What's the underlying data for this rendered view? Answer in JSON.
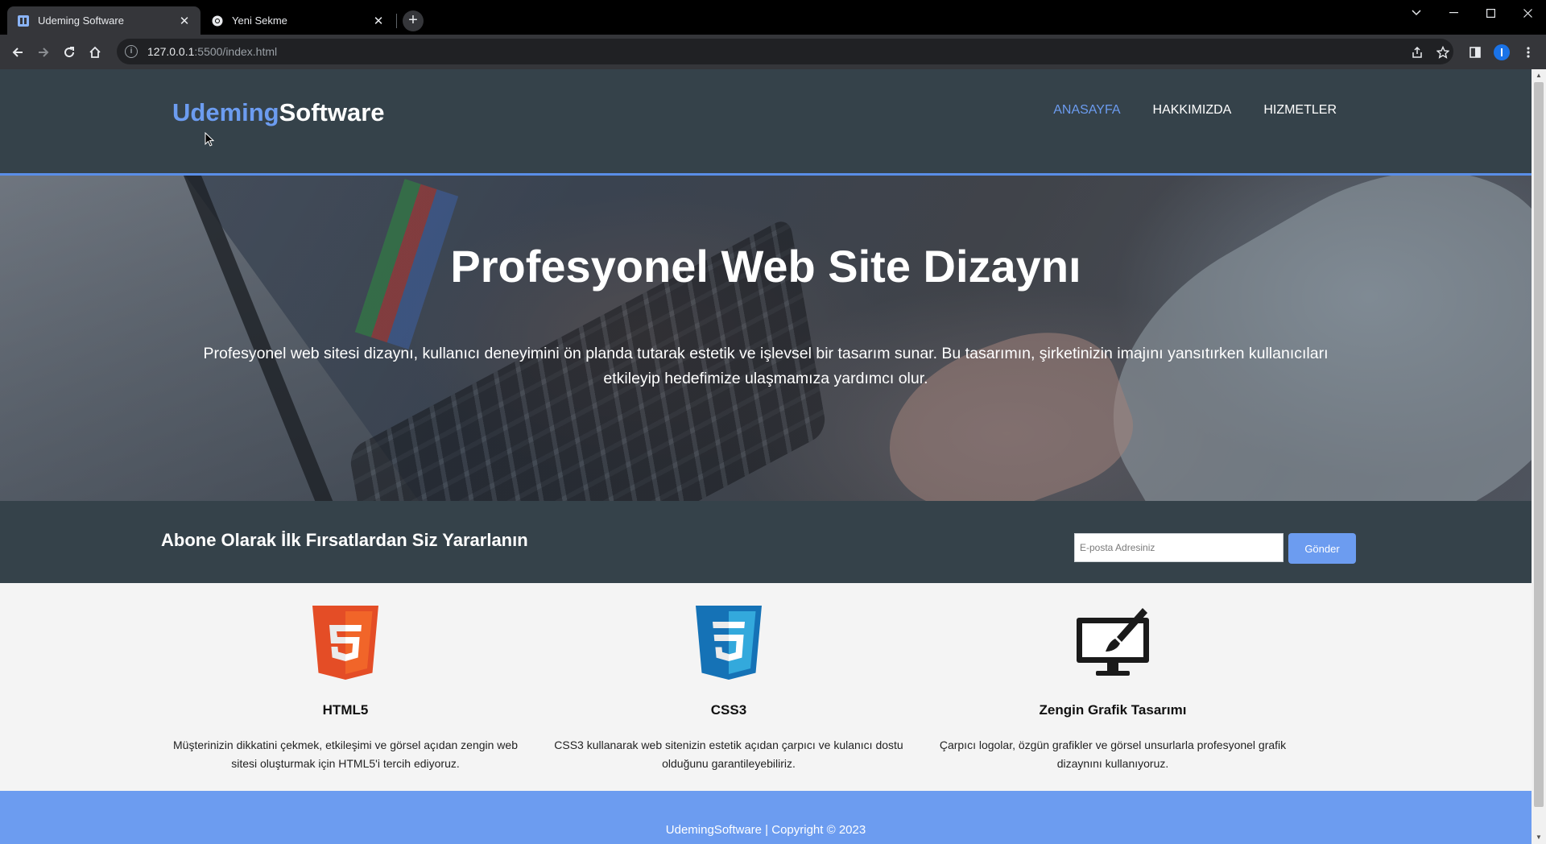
{
  "browser": {
    "tabs": [
      {
        "title": "Udeming Software",
        "active": true
      },
      {
        "title": "Yeni Sekme",
        "active": false
      }
    ],
    "address": {
      "host": "127.0.0.1",
      "path": ":5500/index.html"
    }
  },
  "site": {
    "brand": {
      "part1": "Udeming",
      "part2": "Software"
    },
    "nav": [
      {
        "label": "ANASAYFA",
        "current": true
      },
      {
        "label": "HAKKIMIZDA",
        "current": false
      },
      {
        "label": "HIZMETLER",
        "current": false
      }
    ],
    "hero": {
      "title": "Profesyonel Web Site Dizaynı",
      "text": "Profesyonel web sitesi dizaynı, kullanıcı deneyimini ön planda tutarak estetik ve işlevsel bir tasarım sunar. Bu tasarımın, şirketinizin imajını yansıtırken kullanıcıları etkileyip hedefimize ulaşmamıza yardımcı olur."
    },
    "newsletter": {
      "heading": "Abone Olarak İlk Fırsatlardan Siz Yararlanın",
      "email_placeholder": "E-posta Adresiniz",
      "email_value": "",
      "submit_label": "Gönder"
    },
    "features": [
      {
        "icon": "html5-icon",
        "title": "HTML5",
        "text": "Müşterinizin dikkatini çekmek, etkileşimi ve görsel açıdan zengin web sitesi oluşturmak için HTML5'i tercih ediyoruz."
      },
      {
        "icon": "css3-icon",
        "title": "CSS3",
        "text": "CSS3 kullanarak web sitenizin estetik açıdan çarpıcı ve kulanıcı dostu olduğunu garantileyebiliriz."
      },
      {
        "icon": "monitor-brush-icon",
        "title": "Zengin Grafik Tasarımı",
        "text": "Çarpıcı logolar, özgün grafikler ve görsel unsurlarla profesyonel grafik dizaynını kullanıyoruz."
      }
    ],
    "footer": {
      "text": "UdemingSoftware | Copyright © 2023"
    }
  },
  "colors": {
    "accent": "#6c9cf0",
    "header_bg": "#35424a",
    "features_bg": "#f4f4f4",
    "html5_orange": "#e44d26",
    "css3_blue": "#1572b6"
  }
}
